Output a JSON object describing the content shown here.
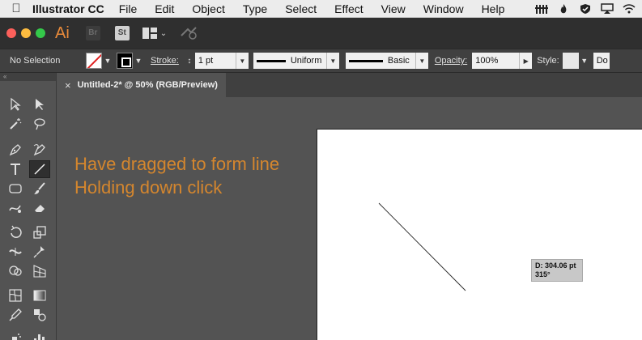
{
  "menubar": {
    "apple_icon": "apple-logo-icon",
    "app_name": "Illustrator CC",
    "items": [
      "File",
      "Edit",
      "Object",
      "Type",
      "Select",
      "Effect",
      "View",
      "Window",
      "Help"
    ],
    "status_icons": [
      "app-status-icon",
      "flame-icon",
      "shield-check-icon",
      "airplay-icon",
      "wifi-icon"
    ]
  },
  "appbar": {
    "logo": "Ai",
    "bridge": "Br",
    "stock": "St"
  },
  "controlbar": {
    "selection_label": "No Selection",
    "stroke_label": "Stroke:",
    "stroke_weight": "1 pt",
    "profile": "Uniform",
    "brush": "Basic",
    "opacity_label": "Opacity:",
    "opacity_value": "100%",
    "style_label": "Style:",
    "doc_setup_fragment": "Do"
  },
  "document": {
    "tab_title": "Untitled-2* @ 50% (RGB/Preview)",
    "close_glyph": "×"
  },
  "canvas": {
    "annotation_line1": "Have dragged to form line",
    "annotation_line2": "Holding down click",
    "measure_distance": "D: 304.06 pt",
    "measure_angle": "315°"
  },
  "colors": {
    "annotation": "#d4862e",
    "ai_orange": "#e88a3a"
  }
}
